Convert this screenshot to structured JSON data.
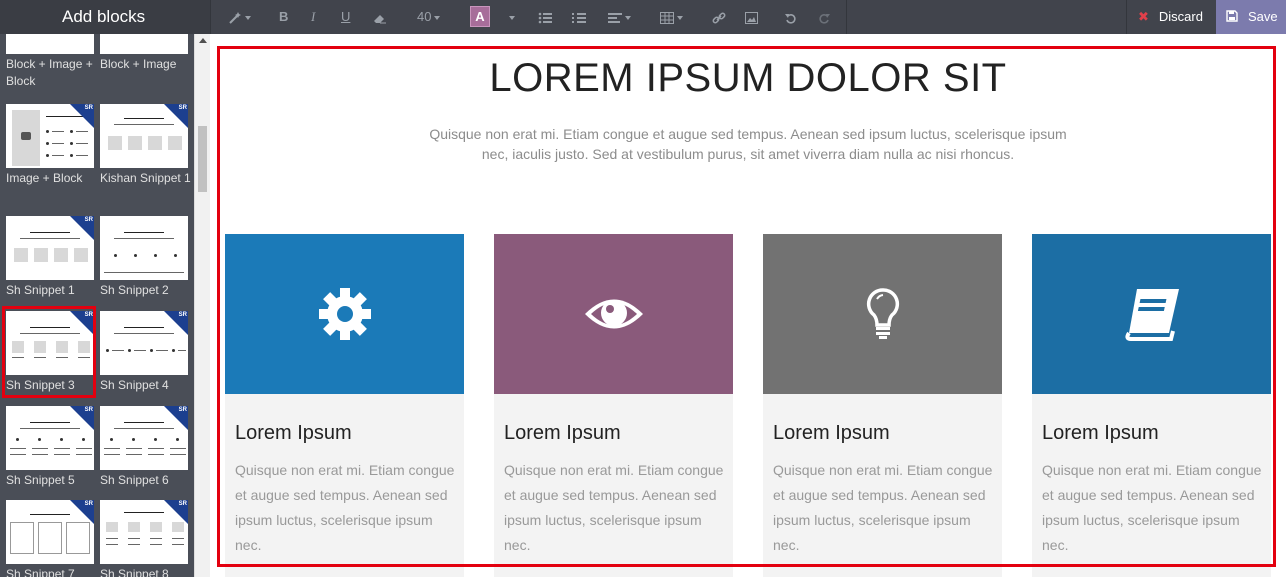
{
  "sidebar": {
    "title": "Add blocks",
    "blocks": [
      {
        "label": "Block + Image + Block"
      },
      {
        "label": "Block + Image"
      },
      {
        "label": "Image + Block"
      },
      {
        "label": "Kishan Snippet 1"
      },
      {
        "label": "Sh Snippet 1"
      },
      {
        "label": "Sh Snippet 2"
      },
      {
        "label": "Sh Snippet 3"
      },
      {
        "label": "Sh Snippet 4"
      },
      {
        "label": "Sh Snippet 5"
      },
      {
        "label": "Sh Snippet 6"
      },
      {
        "label": "Sh Snippet 7"
      },
      {
        "label": "Sh Snippet 8"
      }
    ],
    "badge": "SR"
  },
  "toolbar": {
    "font_size": "40",
    "color_letter": "A",
    "bold": "B",
    "italic": "I",
    "underline": "U",
    "discard_label": "Discard",
    "save_label": "Save"
  },
  "page": {
    "title": "LOREM IPSUM DOLOR SIT",
    "subtitle": "Quisque non erat mi. Etiam congue et augue sed tempus. Aenean sed ipsum luctus, scelerisque ipsum nec, iaculis justo. Sed at vestibulum purus, sit amet viverra diam nulla ac nisi rhoncus.",
    "cards": [
      {
        "icon": "gear-icon",
        "color": "#1b7ab8",
        "title": "Lorem Ipsum",
        "body": "Quisque non erat mi. Etiam congue et augue sed tempus. Aenean sed ipsum luctus, scelerisque ipsum nec."
      },
      {
        "icon": "eye-icon",
        "color": "#8a5a7b",
        "title": "Lorem Ipsum",
        "body": "Quisque non erat mi. Etiam congue et augue sed tempus. Aenean sed ipsum luctus, scelerisque ipsum nec."
      },
      {
        "icon": "lightbulb-icon",
        "color": "#727272",
        "title": "Lorem Ipsum",
        "body": "Quisque non erat mi. Etiam congue et augue sed tempus. Aenean sed ipsum luctus, scelerisque ipsum nec."
      },
      {
        "icon": "book-icon",
        "color": "#1c6ea4",
        "title": "Lorem Ipsum",
        "body": "Quisque non erat mi. Etiam congue et augue sed tempus. Aenean sed ipsum luctus, scelerisque ipsum nec."
      }
    ]
  },
  "colors": {
    "accent": "#7c7bad",
    "selection": "#e3000f",
    "toolbar": "#41444c"
  }
}
